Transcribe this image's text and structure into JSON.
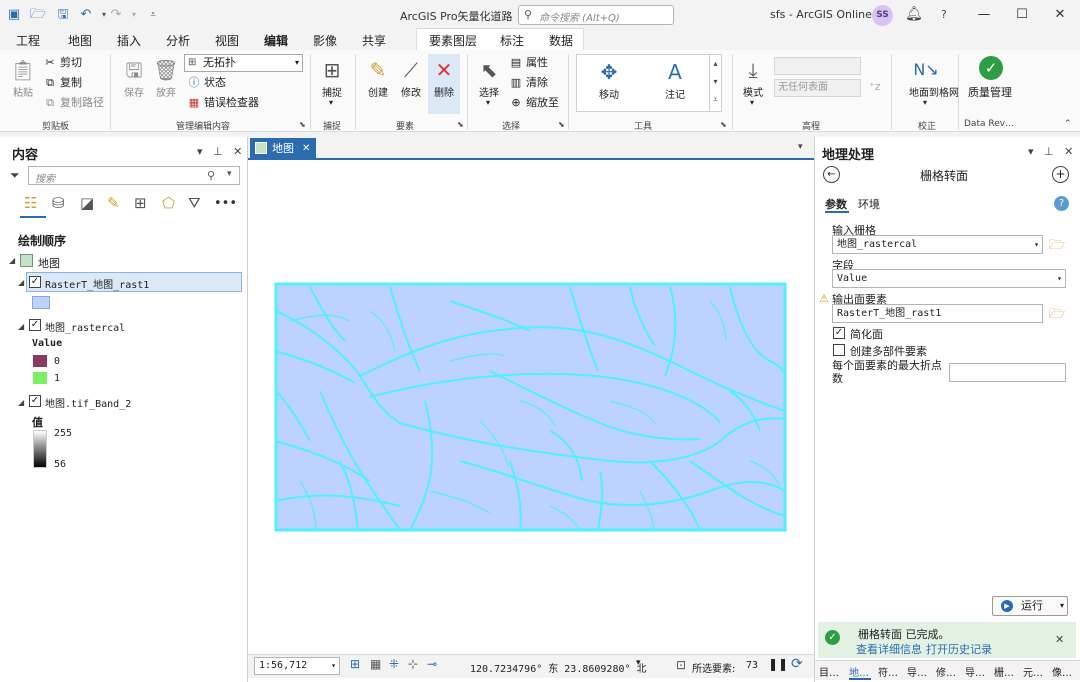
{
  "app": {
    "title": "ArcGIS Pro矢量化道路",
    "search_placeholder": "命令搜索 (Alt+Q)",
    "user": "sfs - ArcGIS Online",
    "avatar": "SS",
    "bell_icon": "bell-icon",
    "help": "?"
  },
  "ribbon_tabs": [
    "工程",
    "地图",
    "插入",
    "分析",
    "视图",
    "编辑",
    "影像",
    "共享"
  ],
  "active_tab": "编辑",
  "context_tabs": [
    "要素图层",
    "标注",
    "数据"
  ],
  "ribbon": {
    "clipboard": {
      "paste": "粘贴",
      "cut": "剪切",
      "copy": "复制",
      "copy_path": "复制路径",
      "label": "剪贴板"
    },
    "manage_edits": {
      "save": "保存",
      "discard": "放弃",
      "topology_value": "无拓扑",
      "status": "状态",
      "error_inspector": "错误检查器",
      "label": "管理编辑内容"
    },
    "snapping": {
      "snap": "捕捉",
      "label": "捕捉"
    },
    "features": {
      "create": "创建",
      "modify": "修改",
      "delete": "删除",
      "label": "要素"
    },
    "selection": {
      "select": "选择",
      "attributes": "属性",
      "clear": "清除",
      "zoom_to": "缩放至",
      "label": "选择"
    },
    "tools": {
      "move": "移动",
      "annotate": "注记",
      "label": "工具"
    },
    "elevation": {
      "mode": "模式",
      "surface_placeholder": "无任何表面",
      "label": "高程"
    },
    "correction": {
      "ground_to_grid": "地面到格网",
      "label": "校正"
    },
    "data_reviewer": {
      "quality": "质量管理",
      "label": "Data Rev…"
    }
  },
  "contents": {
    "title": "内容",
    "search_placeholder": "搜索",
    "drawing_order": "绘制顺序",
    "map_root": "地图",
    "layers": [
      {
        "name": "RasterT_地图_rast1",
        "checked": true,
        "fill": "#bed2ff"
      },
      {
        "name": "地图_rastercal",
        "checked": true,
        "legend_title": "Value",
        "classes": [
          {
            "label": "0",
            "color": "#8b3a62"
          },
          {
            "label": "1",
            "color": "#7cf060"
          }
        ]
      },
      {
        "name": "地图.tif_Band_2",
        "checked": true,
        "legend_title": "值",
        "max": "255",
        "min": "56"
      }
    ]
  },
  "map_tab": {
    "label": "地图",
    "poly_fill": "#bed2ff",
    "line_color": "#4ff0ff"
  },
  "status": {
    "scale": "1:56,712",
    "coords": "120.7234796° 东 23.8609280° 北",
    "selected_label": "所选要素:",
    "selected_count": "73"
  },
  "geoprocessing": {
    "title": "地理处理",
    "tool_name": "栅格转面",
    "tabs": [
      "参数",
      "环境"
    ],
    "input_raster_label": "输入栅格",
    "input_raster_value": "地图_rastercal",
    "field_label": "字段",
    "field_value": "Value",
    "output_label": "输出面要素",
    "output_value": "RasterT_地图_rast1",
    "simplify_label": "简化面",
    "simplify_checked": true,
    "multipart_label": "创建多部件要素",
    "multipart_checked": false,
    "max_vertices_label": "每个面要素的最大折点数",
    "run": "运行",
    "done_msg": "栅格转面 已完成。",
    "view_details": "查看详细信息",
    "open_history": "打开历史记录",
    "bottom_tabs": [
      "目…",
      "地…",
      "符…",
      "导…",
      "修…",
      "导…",
      "栅…",
      "元…",
      "像…"
    ]
  }
}
